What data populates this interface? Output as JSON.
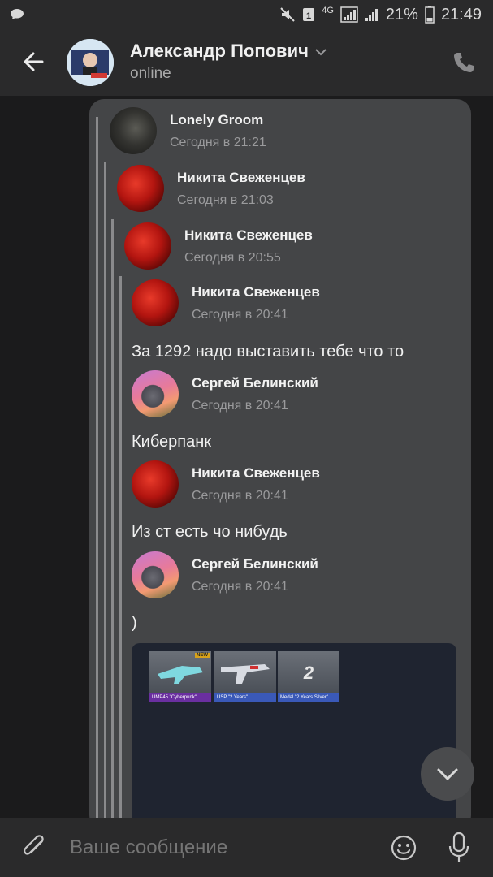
{
  "status_bar": {
    "battery_percent": "21%",
    "time": "21:49",
    "network": "4G"
  },
  "header": {
    "contact_name": "Александр Попович",
    "status": "online"
  },
  "forwarded": [
    {
      "name": "Lonely Groom",
      "time": "Сегодня в 21:21",
      "avatar": "dark"
    },
    {
      "name": "Никита Свеженцев",
      "time": "Сегодня в 21:03",
      "avatar": "red"
    },
    {
      "name": "Никита Свеженцев",
      "time": "Сегодня в 20:55",
      "avatar": "red"
    },
    {
      "name": "Никита Свеженцев",
      "time": "Сегодня в 20:41",
      "avatar": "red"
    }
  ],
  "messages": [
    {
      "text": "За 1292 надо выставить тебе что то"
    },
    {
      "name": "Сергей Белинский",
      "time": "Сегодня в 20:41",
      "text": "Киберпанк"
    },
    {
      "name": "Никита Свеженцев",
      "time": "Сегодня в 20:41",
      "text": "Из ст есть чо нибудь"
    },
    {
      "name": "Сергей Белинский",
      "time": "Сегодня в 20:41",
      "text": ")"
    }
  ],
  "attachment": {
    "items": [
      {
        "caption": "UMP45 \"Cyberpunk\"",
        "badge": "NEW"
      },
      {
        "caption": "USP \"2 Years\""
      },
      {
        "caption": "Medal \"2 Years Silver\""
      }
    ]
  },
  "composer": {
    "placeholder": "Ваше сообщение"
  },
  "colors": {
    "background": "#1b1b1c",
    "bar": "#2a2a2b",
    "bubble": "#444547",
    "text": "#f0f0f0",
    "secondary_text": "#9a9a9c"
  }
}
